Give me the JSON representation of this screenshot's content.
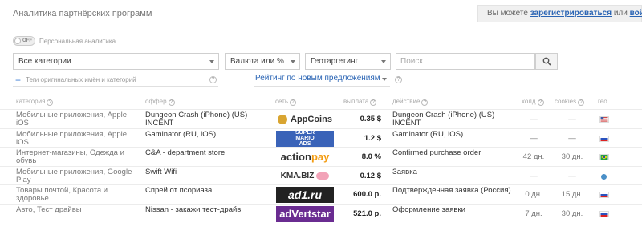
{
  "page": {
    "title": "Аналитика партнёрских программ"
  },
  "login": {
    "prefix": "Вы можете",
    "register_link": "зарегистрироваться",
    "middle": "или",
    "login_link": "войти"
  },
  "toggle": {
    "state": "OFF",
    "label": "Персональная аналитика"
  },
  "filters": {
    "category": "Все категории",
    "currency": "Валюта или %",
    "geo": "Геотаргетинг",
    "search_placeholder": "Поиск",
    "tags_label": "Теги оригинальных имён и категорий",
    "sort": "Рейтинг по новым предложениям"
  },
  "columns": {
    "category": "категория",
    "offer": "оффер",
    "network": "сеть",
    "payout": "выплата",
    "action": "действие",
    "hold": "холд",
    "cookies": "cookies",
    "geo": "гео"
  },
  "rows": [
    {
      "category": "Мобильные приложения, Apple iOS",
      "offer": "Dungeon Crash (iPhone) (US) INCENT",
      "network": "AppCoins",
      "payout": "0.35 $",
      "action": "Dungeon Crash (iPhone) (US) INCENT",
      "hold": "—",
      "cookies": "—",
      "geo": "us-flag"
    },
    {
      "category": "Мобильные приложения, Apple iOS",
      "offer": "Gaminator (RU, iOS)",
      "network": "Super Mario Ads",
      "payout": "1.2 $",
      "action": "Gaminator (RU, iOS)",
      "hold": "—",
      "cookies": "—",
      "geo": "ru-flag"
    },
    {
      "category": "Интернет-магазины, Одежда и обувь",
      "offer": "C&A - department store",
      "network": "actionpay",
      "payout": "8.0 %",
      "action": "Confirmed purchase order",
      "hold": "42 дн.",
      "cookies": "30 дн.",
      "geo": "br-flag"
    },
    {
      "category": "Мобильные приложения, Google Play",
      "offer": "Swift Wifi",
      "network": "KMA.BIZ",
      "payout": "0.12 $",
      "action": "Заявка",
      "hold": "—",
      "cookies": "—",
      "geo": "globe-icon"
    },
    {
      "category": "Товары почтой, Красота и здоровье",
      "offer": "Спрей от псориаза",
      "network": "ad1.ru",
      "payout": "600.0 р.",
      "action": "Подтвержденная заявка (Россия)",
      "hold": "0 дн.",
      "cookies": "15 дн.",
      "geo": "ru-flag"
    },
    {
      "category": "Авто, Тест драйвы",
      "offer": "Nissan - закажи тест-драйв",
      "network": "adVertstar",
      "payout": "521.0 р.",
      "action": "Оформление заявки",
      "hold": "7 дн.",
      "cookies": "30 дн.",
      "geo": "ru-flag"
    }
  ],
  "logos": {
    "appcoins": "AppCoins",
    "mario_1": "SUPER",
    "mario_2": "MARIO",
    "mario_3": "ADS",
    "actionpay_a": "action",
    "actionpay_b": "pay",
    "kma": "KMA.BIZ",
    "ad1": "ad1.ru",
    "advertstar": "adVertstar"
  }
}
